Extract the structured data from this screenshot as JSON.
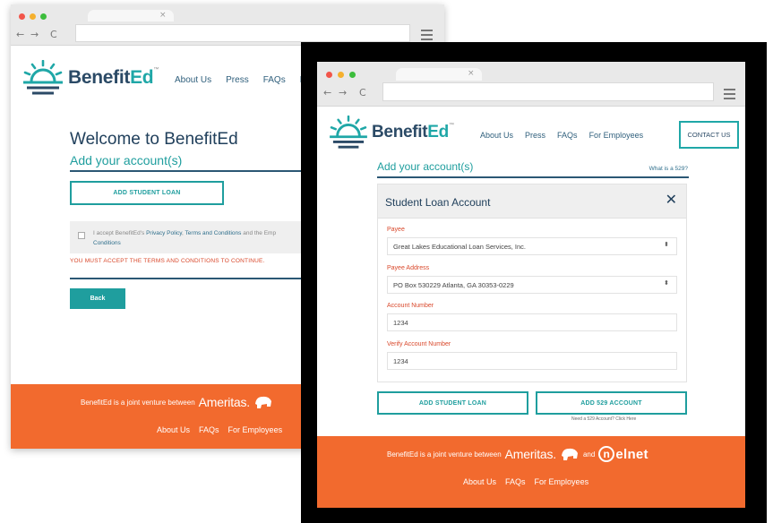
{
  "back_window": {
    "tab_close": "×",
    "nav_back": "←",
    "nav_forward": "→",
    "nav_reload": "C",
    "logo": {
      "name_part1": "Benefit",
      "name_part2": "Ed",
      "tm": "™"
    },
    "nav": [
      "About Us",
      "Press",
      "FAQs",
      "F"
    ],
    "welcome_title": "Welcome to BenefitEd",
    "subtitle": "Add your account(s)",
    "add_student_loan_label": "ADD STUDENT LOAN",
    "accept_text_1": "I accept BenefitEd's ",
    "accept_link_1": "Privacy Policy",
    "accept_text_2": ", ",
    "accept_link_2": "Terms and Conditions",
    "accept_text_3": " and the Emp",
    "accept_link_3": "Conditions",
    "error_text": "YOU MUST ACCEPT THE TERMS AND CONDITIONS TO CONTINUE.",
    "back_label": "Back",
    "footer": {
      "joint_text": "BenefitEd is a joint venture between",
      "ameritas": "Ameritas.",
      "links": [
        "About Us",
        "FAQs",
        "For Employees"
      ]
    }
  },
  "front_window": {
    "tab_close": "×",
    "nav_back": "←",
    "nav_forward": "→",
    "nav_reload": "C",
    "logo": {
      "name_part1": "Benefit",
      "name_part2": "Ed",
      "tm": "™"
    },
    "nav": [
      "About Us",
      "Press",
      "FAQs",
      "For Employees"
    ],
    "contact_label": "CONTACT US",
    "subtitle": "Add your account(s)",
    "what_is_529": "What is a 529?",
    "card": {
      "title": "Student Loan Account",
      "close_glyph": "✕",
      "payee_label": "Payee",
      "payee_value": "Great Lakes Educational Loan Services, Inc.",
      "payee_address_label": "Payee Address",
      "payee_address_value": "PO Box 530229 Atlanta, GA 30353-0229",
      "account_number_label": "Account Number",
      "account_number_value": "1234",
      "verify_label": "Verify Account Number",
      "verify_value": "1234",
      "select_arrows": "⬍"
    },
    "add_student_loan_label": "ADD STUDENT LOAN",
    "add_529_label": "ADD 529 ACCOUNT",
    "need_529_text": "Need a 529 Account? Click Here",
    "footer": {
      "joint_text": "BenefitEd is a joint venture between",
      "ameritas": "Ameritas.",
      "and_text": "and",
      "nelnet_n": "n",
      "nelnet_rest": "elnet",
      "links": [
        "About Us",
        "FAQs",
        "For Employees"
      ]
    }
  },
  "colors": {
    "teal": "#1f9e9e",
    "navy": "#21405c",
    "orange": "#f26a2e",
    "error_red": "#d9482b"
  }
}
